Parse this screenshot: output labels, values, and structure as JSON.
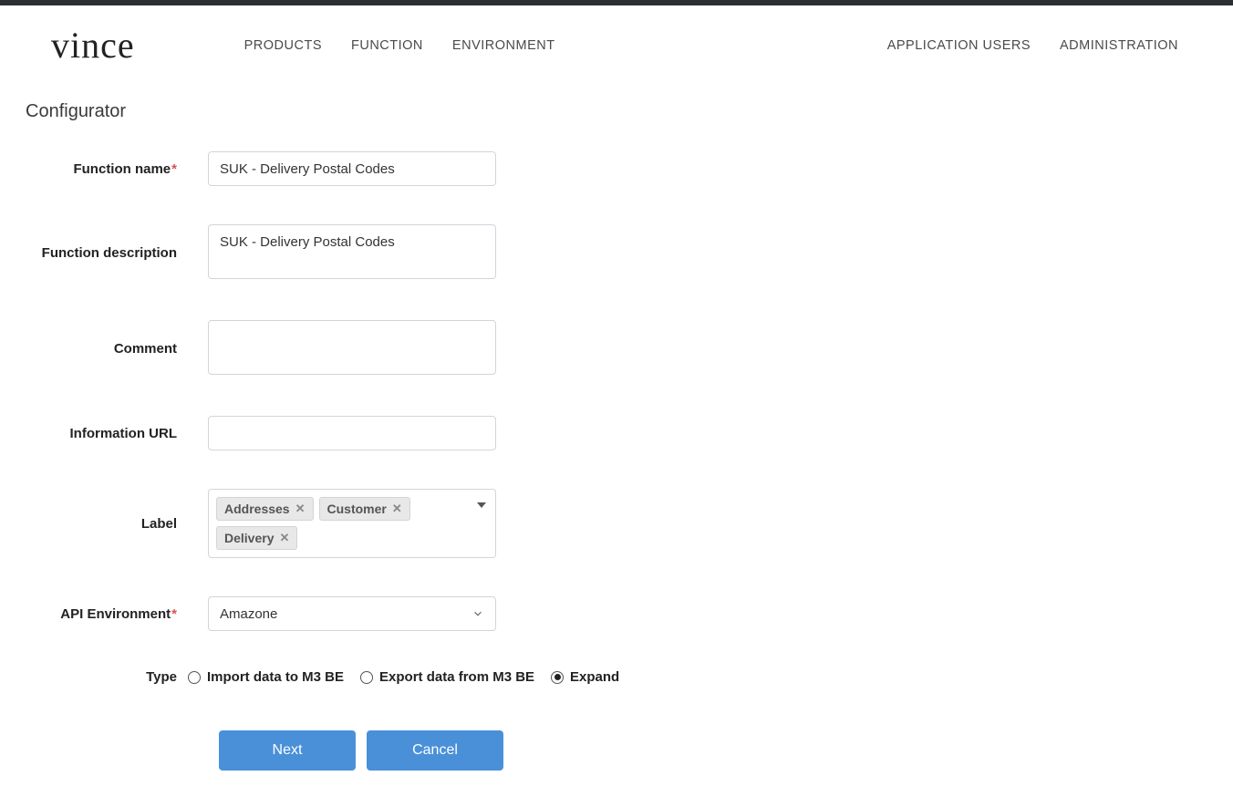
{
  "brand": "vince",
  "nav": {
    "left": [
      "PRODUCTS",
      "FUNCTION",
      "ENVIRONMENT"
    ],
    "right": [
      "APPLICATION USERS",
      "ADMINISTRATION"
    ]
  },
  "page_title": "Configurator",
  "form": {
    "function_name": {
      "label": "Function name",
      "required": true,
      "value": "SUK - Delivery Postal Codes"
    },
    "function_description": {
      "label": "Function description",
      "value": "SUK - Delivery Postal Codes"
    },
    "comment": {
      "label": "Comment",
      "value": ""
    },
    "information_url": {
      "label": "Information URL",
      "value": ""
    },
    "label_field": {
      "label": "Label",
      "tags": [
        "Addresses",
        "Customer",
        "Delivery"
      ]
    },
    "api_environment": {
      "label": "API Environment",
      "required": true,
      "value": "Amazone"
    },
    "type": {
      "label": "Type",
      "options": [
        "Import data to M3 BE",
        "Export data from M3 BE",
        "Expand"
      ],
      "selected_index": 2
    }
  },
  "buttons": {
    "next": "Next",
    "cancel": "Cancel"
  }
}
